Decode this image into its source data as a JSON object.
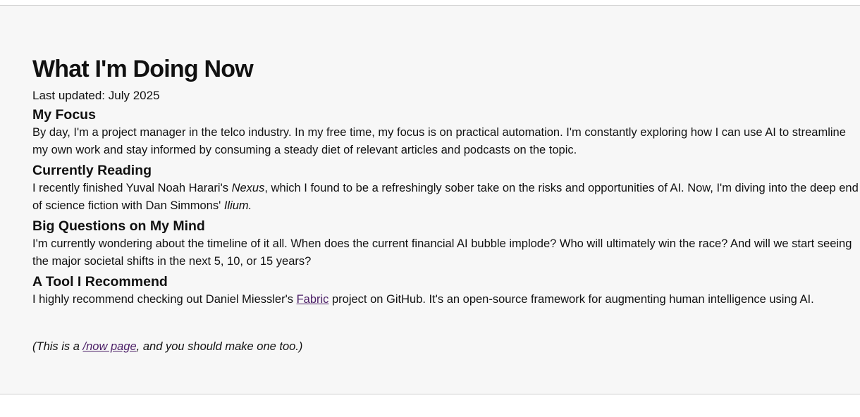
{
  "page": {
    "title": "What I'm Doing Now",
    "updated": "Last updated: July 2025"
  },
  "sections": [
    {
      "heading": "My Focus",
      "text": "By day, I'm a project manager in the telco industry. In my free time, my focus is on practical automation. I'm constantly exploring how I can use AI to streamline my own work and stay informed by consuming a steady diet of relevant articles and podcasts on the topic."
    },
    {
      "heading": "Currently Reading",
      "text_a": "I recently finished Yuval Noah Harari's ",
      "book1": "Nexus",
      "text_b": ", which I found to be a refreshingly sober take on the risks and opportunities of AI. Now, I'm diving into the deep end of science fiction with Dan Simmons' ",
      "book2": "Ilium."
    },
    {
      "heading": "Big Questions on My Mind",
      "text": "I'm currently wondering about the timeline of it all. When does the current financial AI bubble implode? Who will ultimately win the race? And will we start seeing the major societal shifts in the next 5, 10, or 15 years?"
    },
    {
      "heading": "A Tool I Recommend",
      "text_a": "I highly recommend checking out Daniel Miessler's ",
      "link": "Fabric",
      "text_b": " project on GitHub. It's an open-source framework for augmenting human intelligence using AI."
    }
  ],
  "footer": {
    "prefix": "(This is a ",
    "link": "/now page",
    "suffix": ", and you should make one too.)"
  }
}
